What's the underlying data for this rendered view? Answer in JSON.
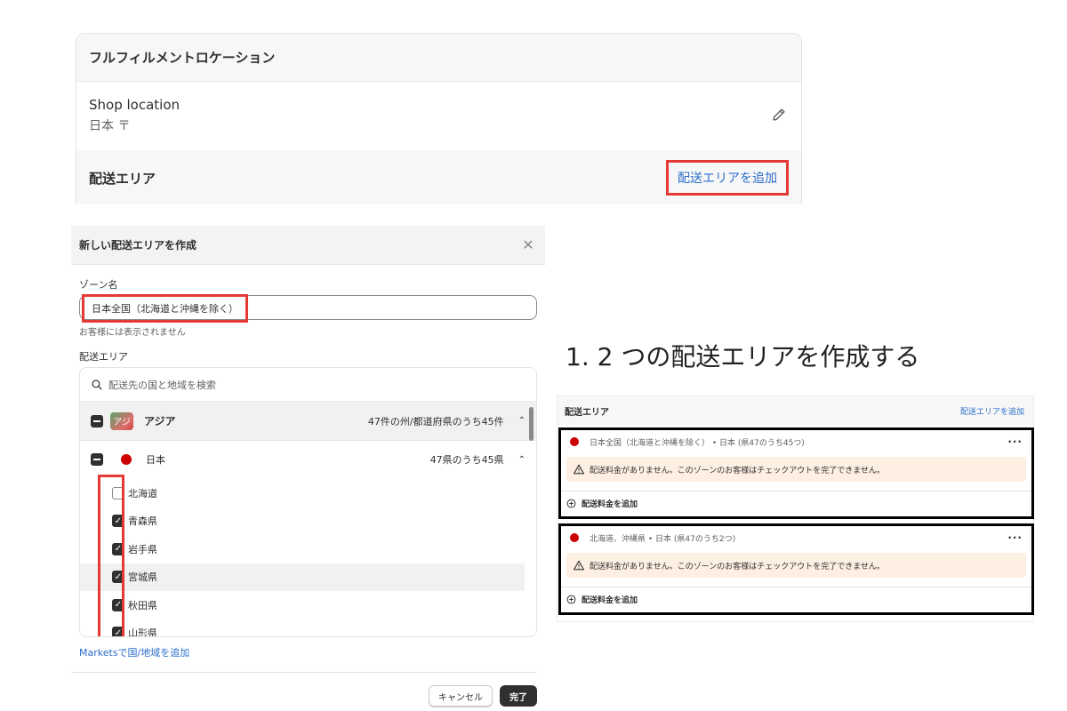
{
  "location_panel": {
    "title": "フルフィルメントロケーション",
    "shop_name": "Shop location",
    "shop_address": "日本 〒",
    "zone_title": "配送エリア",
    "add_zone_link": "配送エリアを追加"
  },
  "modal": {
    "title": "新しい配送エリアを作成",
    "zone_name_label": "ゾーン名",
    "zone_name_value": "日本全国（北海道と沖縄を除く）",
    "zone_name_hint": "お客様には表示されません",
    "area_label": "配送エリア",
    "search_placeholder": "配送先の国と地域を検索",
    "region": {
      "badge": "アジ",
      "name": "アジア",
      "count": "47件の州/都道府県のうち45件"
    },
    "country": {
      "name": "日本",
      "count": "47県のうち45県"
    },
    "prefectures": [
      {
        "name": "北海道",
        "checked": false
      },
      {
        "name": "青森県",
        "checked": true
      },
      {
        "name": "岩手県",
        "checked": true
      },
      {
        "name": "宮城県",
        "checked": true
      },
      {
        "name": "秋田県",
        "checked": true
      },
      {
        "name": "山形県",
        "checked": true
      }
    ],
    "markets_link": "Marketsで国/地域を追加",
    "cancel_label": "キャンセル",
    "done_label": "完了"
  },
  "caption": "1. 2 つの配送エリアを作成する",
  "result_panel": {
    "title": "配送エリア",
    "add_link": "配送エリアを追加",
    "zones": [
      {
        "name": "日本全国（北海道と沖縄を除く） • 日本 (県47のうち45つ)",
        "warning": "配送料金がありません。このゾーンのお客様はチェックアウトを完了できません。",
        "add_rate": "配送料金を追加"
      },
      {
        "name": "北海道、沖縄県 • 日本 (県47のうち2つ)",
        "warning": "配送料金がありません。このゾーンのお客様はチェックアウトを完了できません。",
        "add_rate": "配送料金を追加"
      }
    ]
  },
  "colors": {
    "link": "#2c6ecb",
    "highlight_red": "#e53935",
    "flag_red": "#cc0000",
    "warning_bg": "#fdefe2"
  },
  "icons": [
    "pencil-icon",
    "close-icon",
    "search-icon",
    "chevron-up-icon",
    "checkbox-icon",
    "warning-icon",
    "plus-circle-icon",
    "more-icon"
  ]
}
